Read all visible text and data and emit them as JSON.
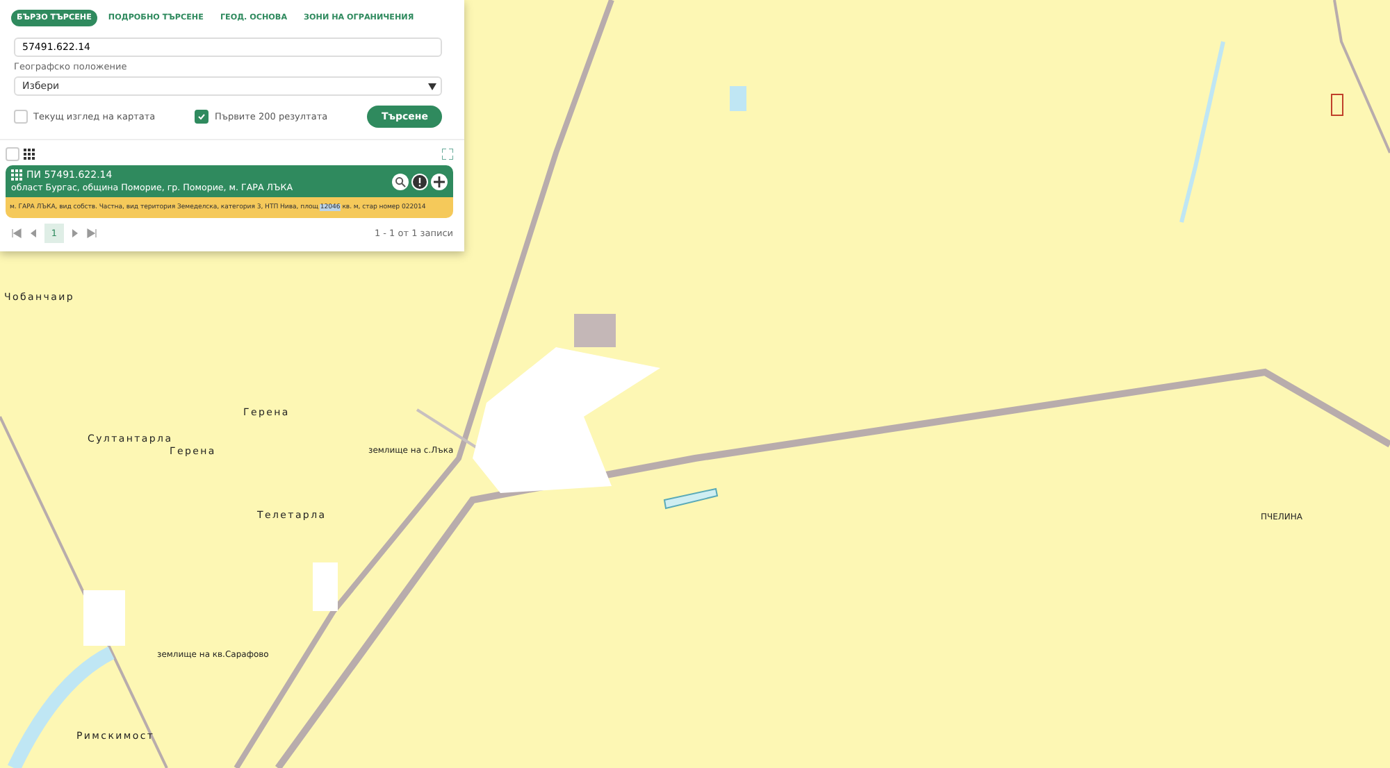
{
  "tabs": [
    {
      "label": "БЪРЗО ТЪРСЕНЕ",
      "selected": true
    },
    {
      "label": "ПОДРОБНО ТЪРСЕНЕ",
      "selected": false
    },
    {
      "label": "ГЕОД. ОСНОВА",
      "selected": false
    },
    {
      "label": "ЗОНИ НА ОГРАНИЧЕНИЯ",
      "selected": false
    }
  ],
  "search": {
    "value": "57491.622.14"
  },
  "location": {
    "label": "Географско положение",
    "value": "Избери"
  },
  "options": [
    {
      "label": "Текущ изглед на картата",
      "checked": false
    },
    {
      "label": "Първите 200 резултата",
      "checked": true
    }
  ],
  "search_button": "Търсене",
  "select_all": {
    "checked": false
  },
  "result": {
    "title": "ПИ 57491.622.14",
    "address": "област Бургас, община Поморие, гр. Поморие, м. ГАРА ЛЪКА",
    "detail": [
      {
        "text": "м. ГАРА ЛЪКА, вид собств. Частна, вид територия Земеделска, категория 3, НТП Нива, площ ",
        "highlighted": false
      },
      {
        "text": "12046",
        "highlighted": true
      },
      {
        "text": " кв. м, стар номер 022014",
        "highlighted": false
      }
    ]
  },
  "pagination": {
    "pages": [
      {
        "label": "1",
        "selected": true
      }
    ],
    "summary": "1 - 1 от 1 записи"
  },
  "map": {
    "labels": [
      {
        "text": "Чобанчаир"
      },
      {
        "text": "Герена"
      },
      {
        "text": "Султантарла"
      },
      {
        "text": "Герена"
      },
      {
        "text": "землище на с.Лъка"
      },
      {
        "text": "Телетарла"
      },
      {
        "text": "землище на кв.Сарафово"
      },
      {
        "text": "Римскимост"
      },
      {
        "text": "ПЧЕЛИНА"
      }
    ]
  }
}
